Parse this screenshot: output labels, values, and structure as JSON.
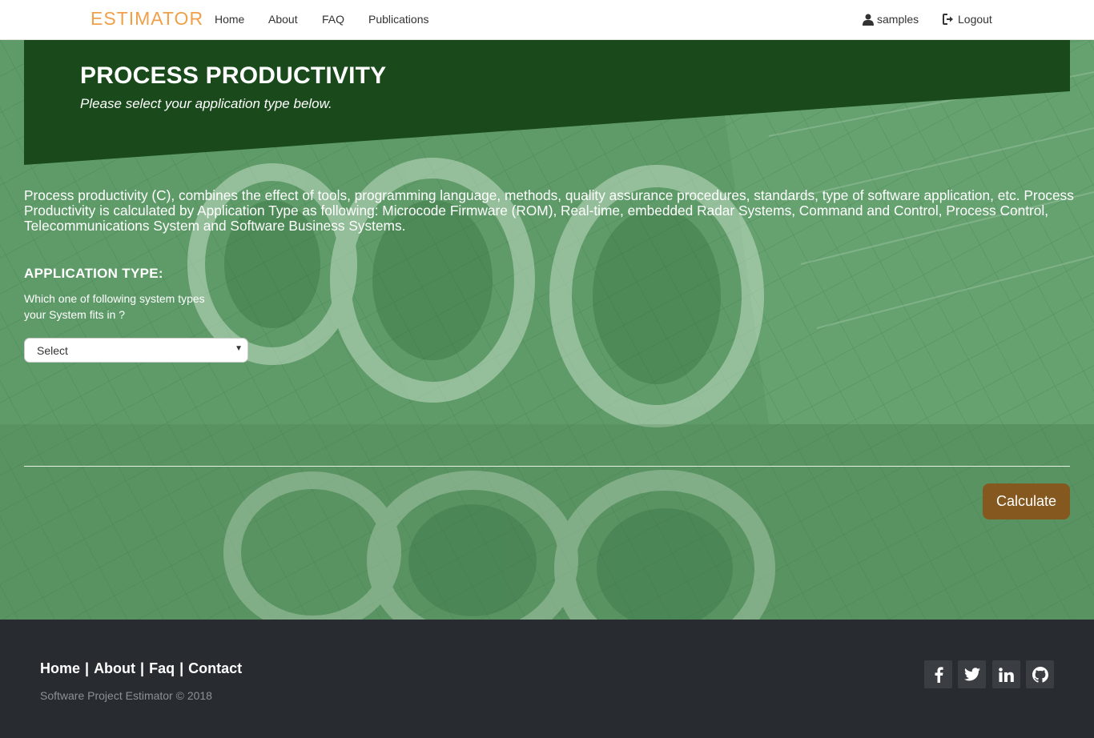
{
  "nav": {
    "brand": "ESTIMATOR",
    "links": [
      "Home",
      "About",
      "FAQ",
      "Publications"
    ],
    "user": "samples",
    "logout": "Logout"
  },
  "hero": {
    "title": "PROCESS PRODUCTIVITY",
    "subtitle": "Please select your application type below."
  },
  "content": {
    "description": "Process productivity (C), combines the effect of tools, programming language, methods, quality assurance procedures, standards, type of software application, etc. Process Productivity is calculated by Application Type as following: Microcode Firmware (ROM), Real-time, embedded Radar Systems, Command and Control, Process Control, Telecommunications System and Software Business Systems.",
    "section_heading": "APPLICATION TYPE:",
    "question": "Which one of following system types your System fits in ?",
    "select_value": "Select",
    "calculate_label": "Calculate"
  },
  "footer": {
    "links": [
      "Home",
      "About",
      "Faq",
      "Contact"
    ],
    "separator": "|",
    "copyright": "Software Project Estimator © 2018",
    "social_icons": [
      "facebook-icon",
      "twitter-icon",
      "linkedin-icon",
      "github-icon"
    ]
  },
  "colors": {
    "brand": "#f0a049",
    "banner": "#1a4a1c",
    "background": "#5f9b69",
    "button": "#84581e",
    "footer": "#282b2f"
  }
}
